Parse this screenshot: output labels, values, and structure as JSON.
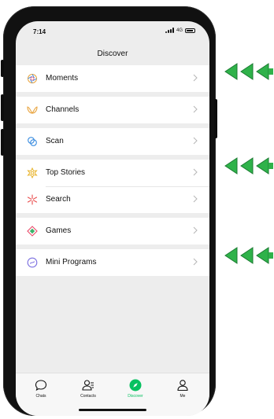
{
  "status": {
    "time": "7:14",
    "network": "4G"
  },
  "header": {
    "title": "Discover"
  },
  "menu": [
    {
      "label": "Moments",
      "icon": "moments-icon"
    },
    {
      "label": "Channels",
      "icon": "channels-icon"
    },
    {
      "label": "Scan",
      "icon": "scan-icon"
    },
    {
      "label": "Top Stories",
      "icon": "top-stories-icon"
    },
    {
      "label": "Search",
      "icon": "search-icon"
    },
    {
      "label": "Games",
      "icon": "games-icon"
    },
    {
      "label": "Mini Programs",
      "icon": "mini-programs-icon"
    }
  ],
  "tabs": [
    {
      "label": "Chats",
      "icon": "chat-bubble-icon"
    },
    {
      "label": "Contacts",
      "icon": "contacts-icon"
    },
    {
      "label": "Discover",
      "icon": "compass-icon",
      "active": true
    },
    {
      "label": "Me",
      "icon": "person-icon"
    }
  ],
  "colors": {
    "accent": "#07c160",
    "pointer_arrow": "#2fb24a"
  }
}
